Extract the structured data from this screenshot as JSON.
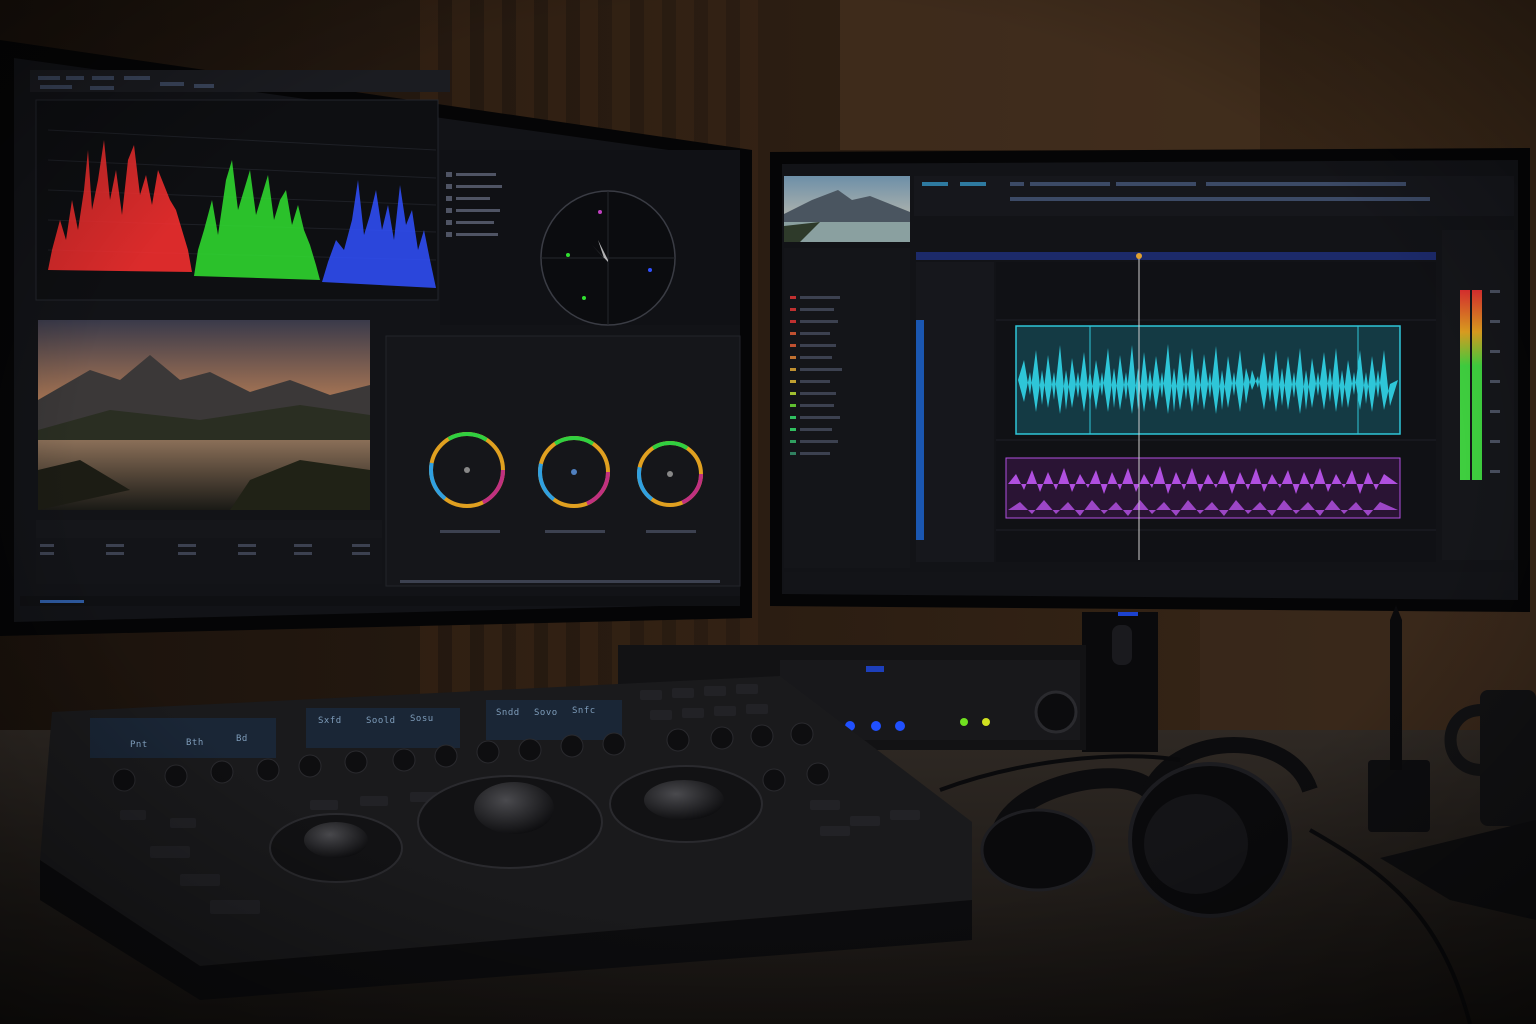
{
  "scene": {
    "title": "",
    "colors": {
      "wall": "#2a1c12",
      "desk": "#2b2621",
      "bezel": "#050506",
      "ui_background": "#111216",
      "ui_panel": "#17181d",
      "scope_red": "#ff3030",
      "scope_green": "#30e030",
      "scope_blue": "#3050ff",
      "wave_cyan": "#2ec6d8",
      "wave_purple": "#b04fe0",
      "playhead": "#e0a030",
      "meter_green": "#3fcf3f",
      "meter_amber": "#e0a020",
      "meter_red": "#e03030",
      "led_blue": "#2050ff",
      "led_green": "#70e020"
    }
  },
  "left_monitor": {
    "content": "color-grading-software",
    "parade_channels": [
      "red",
      "green",
      "blue"
    ],
    "color_wheels": 3,
    "viewer_image": "mountain-lake-sunset"
  },
  "right_monitor": {
    "content": "audio-editing-software",
    "thumbnail_image": "mountain-lake",
    "waveform_tracks": [
      "cyan-track",
      "purple-track-a",
      "purple-track-b"
    ],
    "level_meter": true
  },
  "control_panel": {
    "trackballs": 3,
    "lcd_displays": 3,
    "lcd_lines": [
      [
        "Pnt",
        "Bth",
        "Bd"
      ],
      [
        "Sxfd",
        "Soold",
        "Sosu"
      ],
      [
        "Sndd",
        "Sovo",
        "Snfc"
      ]
    ]
  },
  "props": [
    "headphones",
    "coffee-mug",
    "pen-holder",
    "audio-interface"
  ]
}
